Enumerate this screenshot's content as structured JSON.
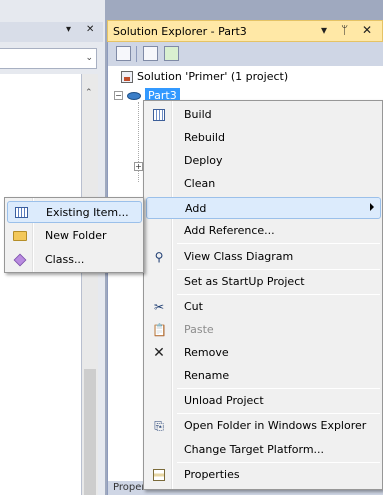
{
  "left_pane": {
    "controls": [
      "▾",
      "✕"
    ],
    "combo_arrow": "⌄",
    "scroll_up": "⌃"
  },
  "solution_explorer": {
    "title": "Solution Explorer - Part3",
    "title_controls": [
      "▾",
      "ᛘ",
      "✕"
    ],
    "tree": {
      "solution_label": "Solution 'Primer' (1 project)",
      "project_label": "Part3",
      "expander_minus": "−",
      "expander_plus": "+"
    }
  },
  "properties_panel": {
    "title": "Properties",
    "title_controls": [
      "▾",
      "ᛘ",
      "✕"
    ]
  },
  "context_menu": {
    "items": [
      {
        "label": "Build",
        "icon": "build-icon",
        "glyph": "",
        "disabled": false
      },
      {
        "label": "Rebuild",
        "icon": "",
        "glyph": "",
        "disabled": false
      },
      {
        "label": "Deploy",
        "icon": "",
        "glyph": "",
        "disabled": false
      },
      {
        "label": "Clean",
        "icon": "",
        "glyph": "",
        "disabled": false
      },
      {
        "label": "Add",
        "icon": "",
        "glyph": "",
        "disabled": false,
        "highlight": true,
        "submenu": true
      },
      {
        "label": "Add Reference...",
        "icon": "",
        "glyph": "",
        "disabled": false
      },
      {
        "label": "View Class Diagram",
        "icon": "class-diagram-icon",
        "glyph": "⚲",
        "disabled": false
      },
      {
        "label": "Set as StartUp Project",
        "icon": "",
        "glyph": "",
        "disabled": false
      },
      {
        "label": "Cut",
        "icon": "scissors-icon",
        "glyph": "✂",
        "disabled": false
      },
      {
        "label": "Paste",
        "icon": "paste-icon",
        "glyph": "📋",
        "disabled": true
      },
      {
        "label": "Remove",
        "icon": "remove-icon",
        "glyph": "✕",
        "disabled": false
      },
      {
        "label": "Rename",
        "icon": "",
        "glyph": "",
        "disabled": false
      },
      {
        "label": "Unload Project",
        "icon": "",
        "glyph": "",
        "disabled": false
      },
      {
        "label": "Open Folder in Windows Explorer",
        "icon": "open-folder-icon",
        "glyph": "⎘",
        "disabled": false
      },
      {
        "label": "Change Target Platform...",
        "icon": "",
        "glyph": "",
        "disabled": false
      },
      {
        "label": "Properties",
        "icon": "properties-icon",
        "glyph": "",
        "disabled": false
      }
    ]
  },
  "add_submenu": {
    "items": [
      {
        "label": "Existing Item...",
        "icon": "existing-item-icon",
        "highlight": true
      },
      {
        "label": "New Folder",
        "icon": "new-folder-icon",
        "highlight": false
      },
      {
        "label": "Class...",
        "icon": "class-icon",
        "highlight": false
      }
    ]
  },
  "colors": {
    "title_active_bg": "#ffe8a6",
    "selection_bg": "#3399ff",
    "menu_highlight_bg": "#dcebfc",
    "menu_highlight_border": "#9bc0ea",
    "disabled_text": "#8d8d8d"
  }
}
